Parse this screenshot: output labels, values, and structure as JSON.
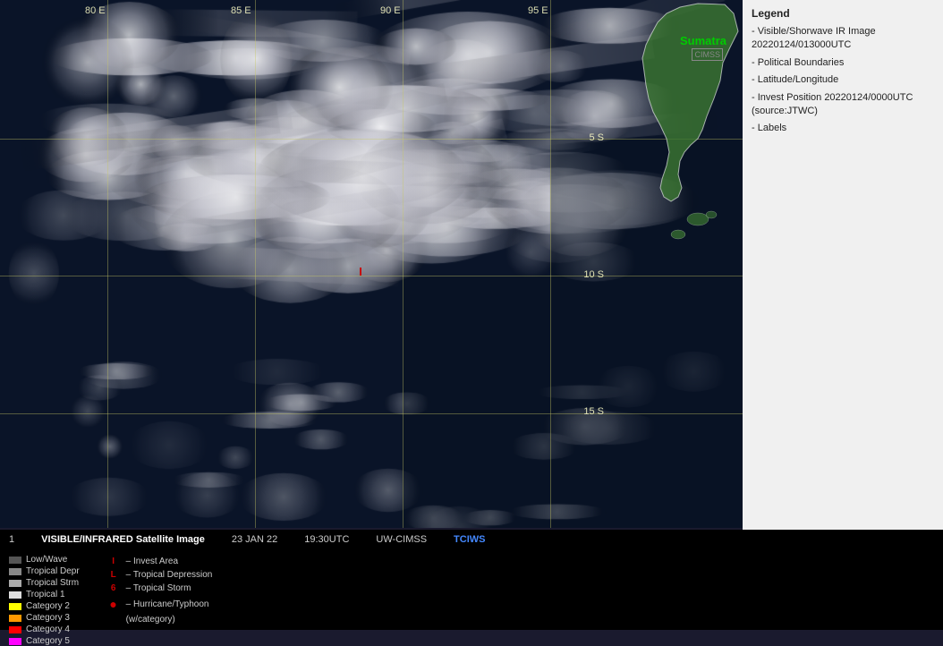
{
  "title": "VISIBLE/INFRARED Satellite Image",
  "datetime": "23 JAN 22",
  "time_utc": "19:30UTC",
  "source": "UW-CIMSS",
  "source_link": "TCIWS",
  "map": {
    "lon_labels": [
      "80 E",
      "85 E",
      "90 E",
      "95 E"
    ],
    "lat_labels": [
      "5 S",
      "10 S",
      "15 S"
    ],
    "region": "Sumatra"
  },
  "legend": {
    "title": "Legend",
    "items": [
      "- Visible/Shorwave IR Image",
      "20220124/013000UTC",
      "",
      "- Political Boundaries",
      "- Latitude/Longitude",
      "- Invest Position  20220124/0000UTC",
      "(source:JTWC)",
      "- Labels"
    ]
  },
  "intensity_legend": {
    "items": [
      {
        "label": "Low/Wave",
        "color": "#555555"
      },
      {
        "label": "Tropical Depr",
        "color": "#888888"
      },
      {
        "label": "Tropical Strm",
        "color": "#aaaaaa"
      },
      {
        "label": "Tropical 1",
        "color": "#ffffff"
      },
      {
        "label": "Category 2",
        "color": "#ffff00"
      },
      {
        "label": "Category 3",
        "color": "#ff9900"
      },
      {
        "label": "Category 4",
        "color": "#ff0000"
      },
      {
        "label": "Category 5",
        "color": "#ff00ff"
      }
    ]
  },
  "symbol_legend": {
    "items": [
      {
        "symbol": "I",
        "label": "Invest Area",
        "color": "#cc0000"
      },
      {
        "symbol": "L",
        "label": "Tropical Depression",
        "color": "#cc0000"
      },
      {
        "symbol": "6",
        "label": "Tropical Storm",
        "color": "#cc0000"
      },
      {
        "symbol": "●",
        "label": "Hurricane/Typhoon",
        "color": "#cc0000"
      },
      {
        "symbol": "",
        "label": "(w/category)",
        "color": "#888888"
      }
    ]
  },
  "invest_marker": {
    "type": "Invest Area",
    "symbol": "I",
    "position_lat": "10S",
    "position_lon": "90E"
  },
  "sumatra_label": "Sumatra",
  "cimss_label": "CIMSS"
}
